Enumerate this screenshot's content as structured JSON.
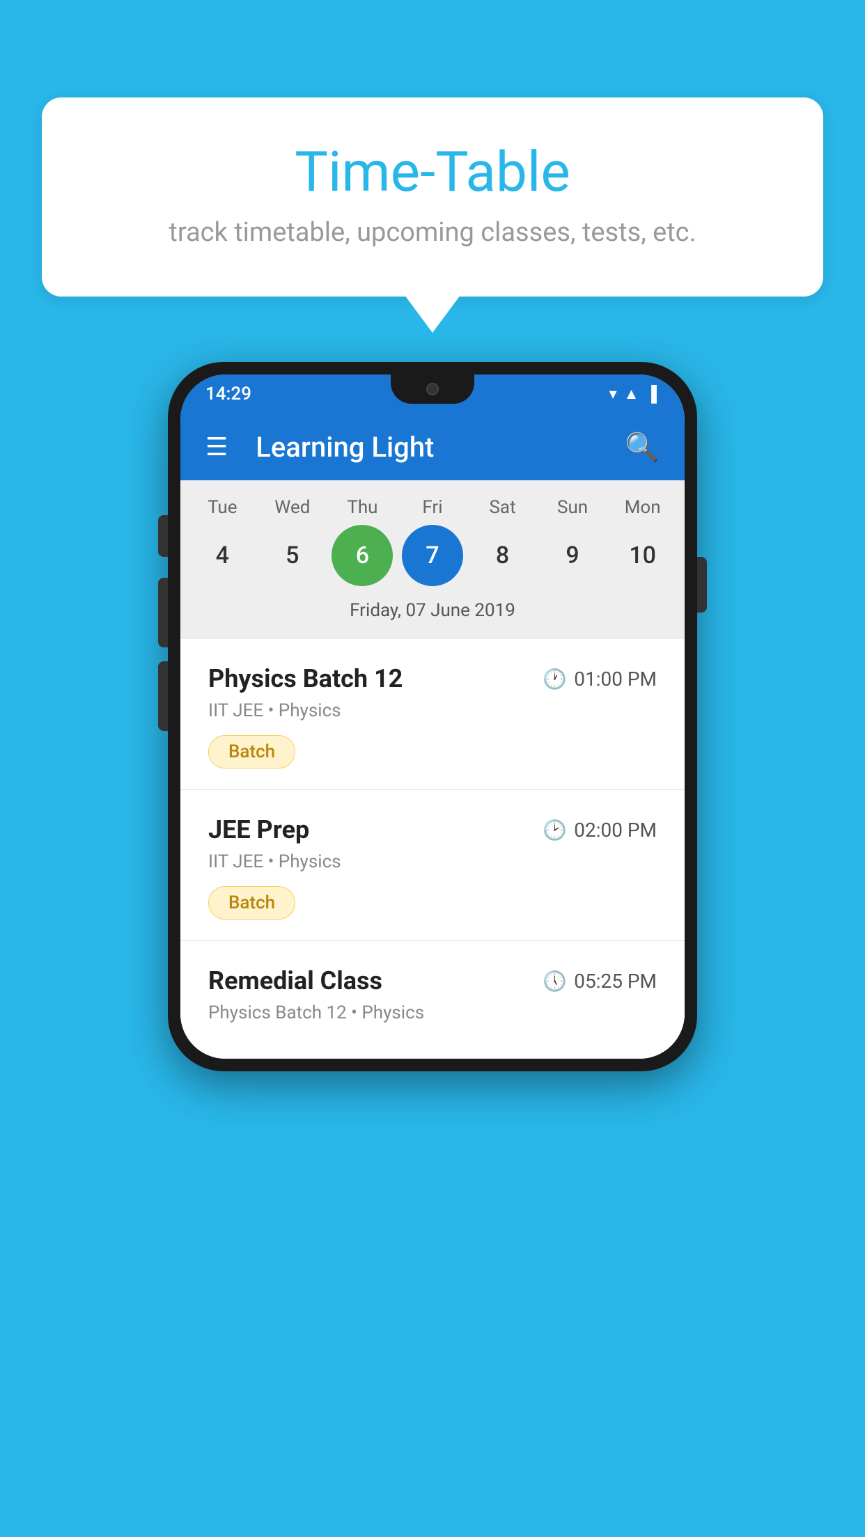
{
  "background": {
    "color": "#29b6e8"
  },
  "speech_bubble": {
    "title": "Time-Table",
    "subtitle": "track timetable, upcoming classes, tests, etc."
  },
  "phone": {
    "status_bar": {
      "time": "14:29"
    },
    "app_bar": {
      "title": "Learning Light"
    },
    "calendar": {
      "days": [
        {
          "label": "Tue",
          "number": "4"
        },
        {
          "label": "Wed",
          "number": "5"
        },
        {
          "label": "Thu",
          "number": "6",
          "state": "today"
        },
        {
          "label": "Fri",
          "number": "7",
          "state": "selected"
        },
        {
          "label": "Sat",
          "number": "8"
        },
        {
          "label": "Sun",
          "number": "9"
        },
        {
          "label": "Mon",
          "number": "10"
        }
      ],
      "selected_date": "Friday, 07 June 2019"
    },
    "schedule": [
      {
        "title": "Physics Batch 12",
        "time": "01:00 PM",
        "subtitle": "IIT JEE • Physics",
        "tag": "Batch"
      },
      {
        "title": "JEE Prep",
        "time": "02:00 PM",
        "subtitle": "IIT JEE • Physics",
        "tag": "Batch"
      },
      {
        "title": "Remedial Class",
        "time": "05:25 PM",
        "subtitle": "Physics Batch 12 • Physics",
        "tag": ""
      }
    ]
  }
}
